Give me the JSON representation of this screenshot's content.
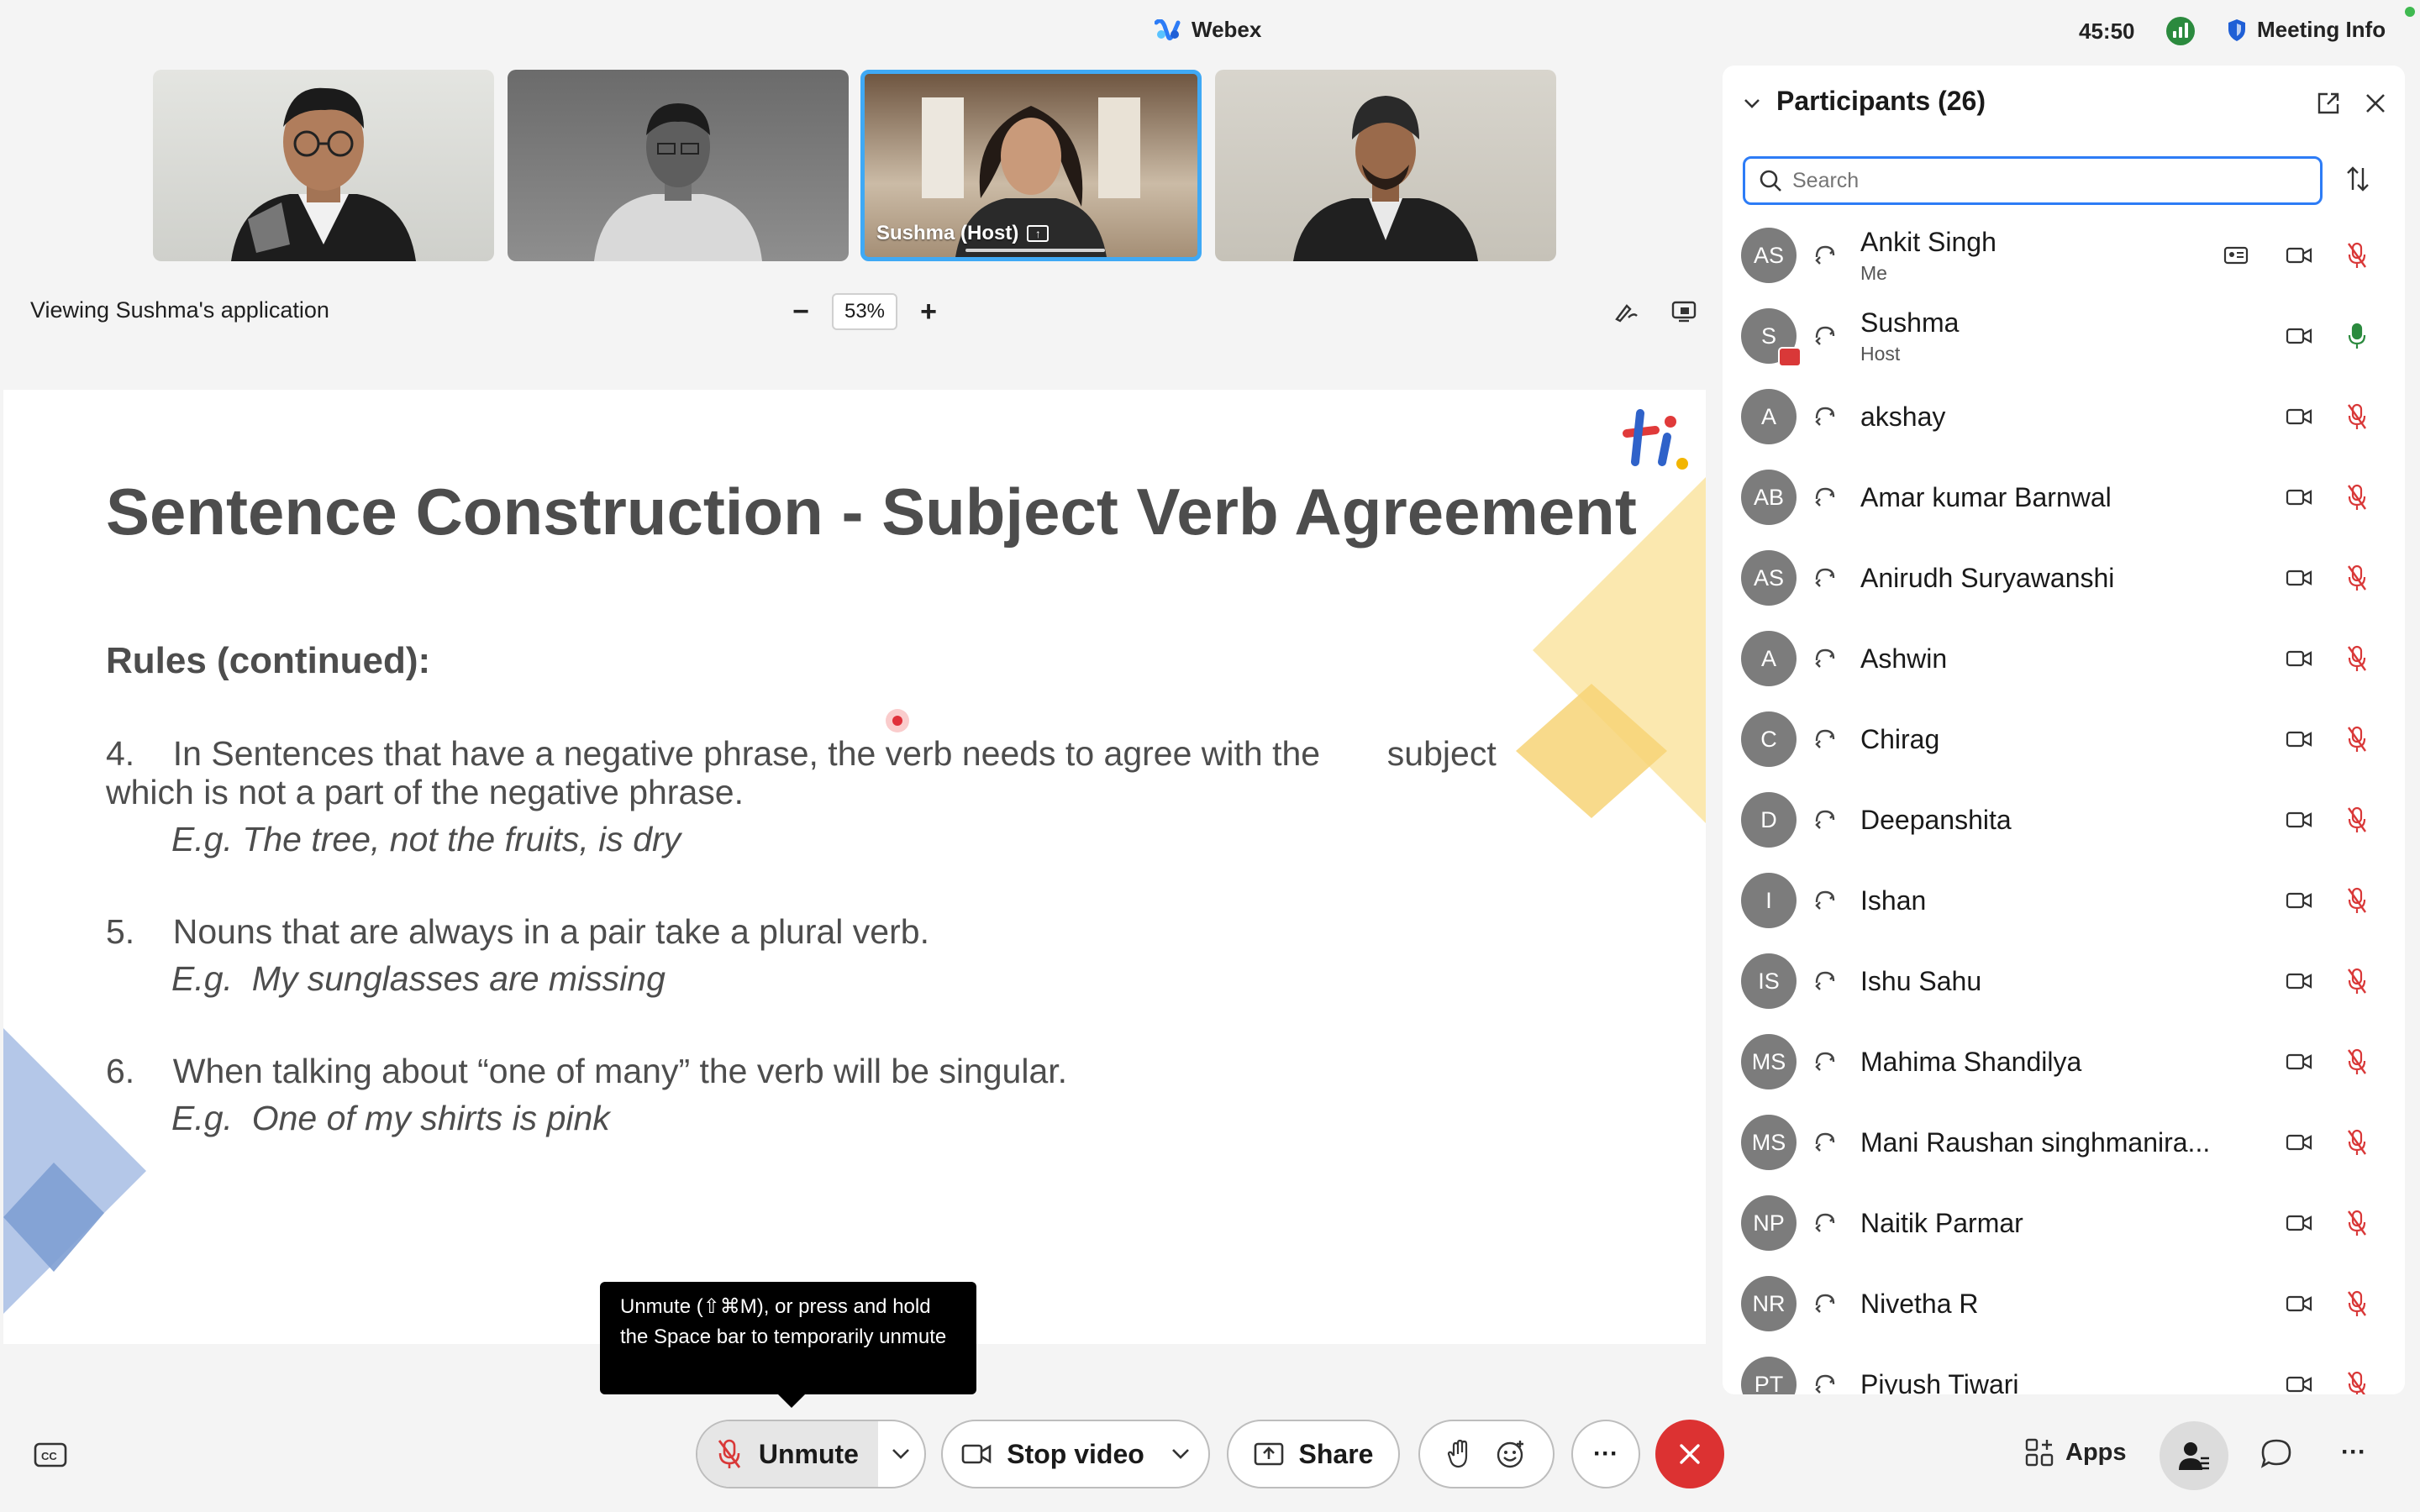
{
  "topbar": {
    "app_title": "Webex",
    "timer": "45:50",
    "meeting_info_label": "Meeting Info"
  },
  "video_tiles": [
    {
      "label": ""
    },
    {
      "label": ""
    },
    {
      "label": "Sushma  (Host)"
    },
    {
      "label": ""
    }
  ],
  "share_bar": {
    "viewing_label": "Viewing Sushma's application",
    "zoom_minus": "−",
    "zoom_value": "53%",
    "zoom_plus": "+"
  },
  "slide": {
    "title": "Sentence Construction - Subject Verb Agreement",
    "rules_heading": "Rules (continued):",
    "rule4_line1": "4.    In Sentences that have a negative phrase, the verb needs to agree with the       subject",
    "rule4_line2": "which is not a part of the negative phrase.",
    "rule4_example": "E.g. The tree, not the fruits, is dry",
    "rule5_line": "5.    Nouns that are always in a pair take a plural verb.",
    "rule5_example": "E.g.  My sunglasses are missing",
    "rule6_line": "6.    When talking about “one of many” the verb will be singular.",
    "rule6_example": "E.g.  One of my shirts is pink"
  },
  "participants": {
    "title": "Participants (26)",
    "search_placeholder": "Search",
    "list": [
      {
        "initials": "AS",
        "name": "Ankit Singh",
        "sub": "Me",
        "mic": "muted"
      },
      {
        "initials": "S",
        "name": "Sushma",
        "sub": "Host",
        "mic": "on"
      },
      {
        "initials": "A",
        "name": "akshay",
        "sub": "",
        "mic": "muted"
      },
      {
        "initials": "AB",
        "name": "Amar kumar Barnwal",
        "sub": "",
        "mic": "muted"
      },
      {
        "initials": "AS",
        "name": "Anirudh Suryawanshi",
        "sub": "",
        "mic": "muted"
      },
      {
        "initials": "A",
        "name": "Ashwin",
        "sub": "",
        "mic": "muted"
      },
      {
        "initials": "C",
        "name": "Chirag",
        "sub": "",
        "mic": "muted"
      },
      {
        "initials": "D",
        "name": "Deepanshita",
        "sub": "",
        "mic": "muted"
      },
      {
        "initials": "I",
        "name": "Ishan",
        "sub": "",
        "mic": "muted"
      },
      {
        "initials": "IS",
        "name": "Ishu Sahu",
        "sub": "",
        "mic": "muted"
      },
      {
        "initials": "MS",
        "name": "Mahima Shandilya",
        "sub": "",
        "mic": "muted"
      },
      {
        "initials": "MS",
        "name": "Mani Raushan singhmanira...",
        "sub": "",
        "mic": "muted"
      },
      {
        "initials": "NP",
        "name": "Naitik Parmar",
        "sub": "",
        "mic": "muted"
      },
      {
        "initials": "NR",
        "name": "Nivetha R",
        "sub": "",
        "mic": "muted"
      },
      {
        "initials": "PT",
        "name": "Piyush Tiwari",
        "sub": "",
        "mic": "muted"
      }
    ]
  },
  "tooltip": {
    "text": "Unmute (⇧⌘M), or press and hold the Space bar to temporarily unmute"
  },
  "controls": {
    "unmute_label": "Unmute",
    "stop_video_label": "Stop video",
    "share_label": "Share",
    "more_label": "···",
    "apps_label": "Apps",
    "more_right_label": "···"
  },
  "colors": {
    "accent": "#3fa9f5",
    "leave": "#dc3232",
    "muted_mic": "#d93838",
    "active_mic": "#2b8a3e",
    "slide_text": "#4d4d4d"
  }
}
